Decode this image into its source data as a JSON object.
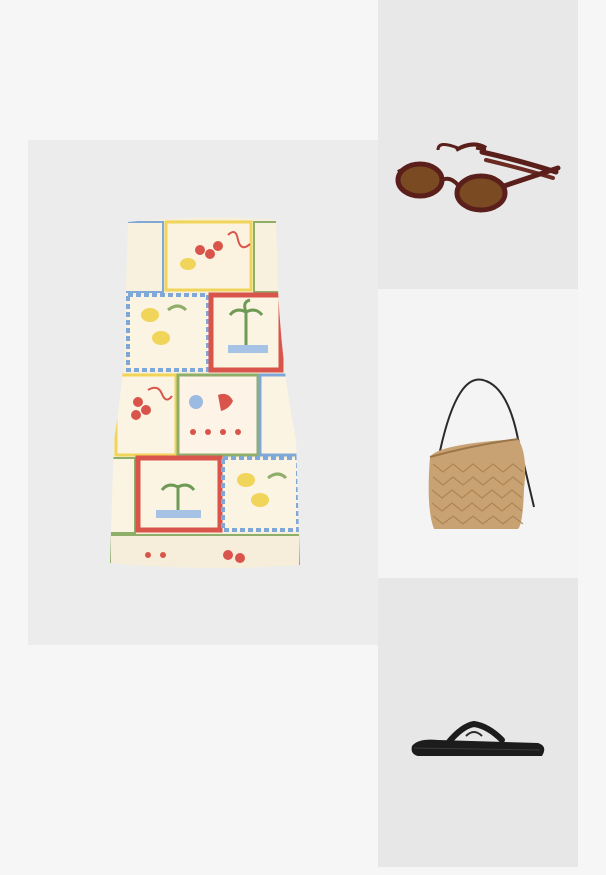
{
  "outfit": {
    "items": [
      {
        "name": "dress",
        "icon": "strapless-printed-mini-dress"
      },
      {
        "name": "sunglasses",
        "icon": "oval-sunglasses"
      },
      {
        "name": "bag",
        "icon": "woven-straw-shoulder-bag"
      },
      {
        "name": "sandals",
        "icon": "flip-flop-sandal"
      }
    ]
  },
  "colors": {
    "dress_base": "#f5efdc",
    "dress_red": "#d9544a",
    "dress_blue": "#7fa7d8",
    "dress_yellow": "#f1d45a",
    "dress_green": "#8fae6a",
    "sunglasses_frame": "#5a1f1a",
    "sunglasses_lens": "#7a4a22",
    "bag_straw": "#c9a274",
    "sandal_black": "#1c1c1c"
  }
}
